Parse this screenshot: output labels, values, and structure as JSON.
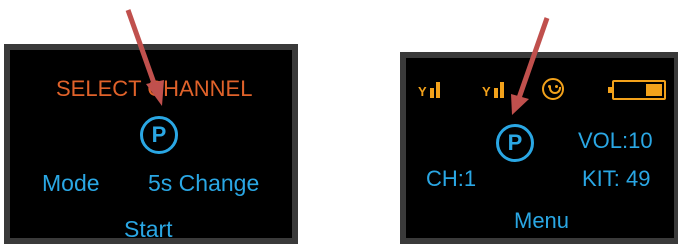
{
  "left_screen": {
    "title": "SELECT CHANNEL",
    "icon_letter": "P",
    "mode_label": "Mode",
    "change_label": "5s Change",
    "start_label": "Start"
  },
  "right_screen": {
    "icon_letter": "P",
    "volume": "VOL:10",
    "channel": "CH:1",
    "kit": "KIT: 49",
    "menu_label": "Menu",
    "battery_level": 0.35
  },
  "colors": {
    "title_orange": "#e0622a",
    "text_blue": "#2aa7e4",
    "status_orange": "#f3a21b",
    "arrow_red": "#c0504d"
  }
}
